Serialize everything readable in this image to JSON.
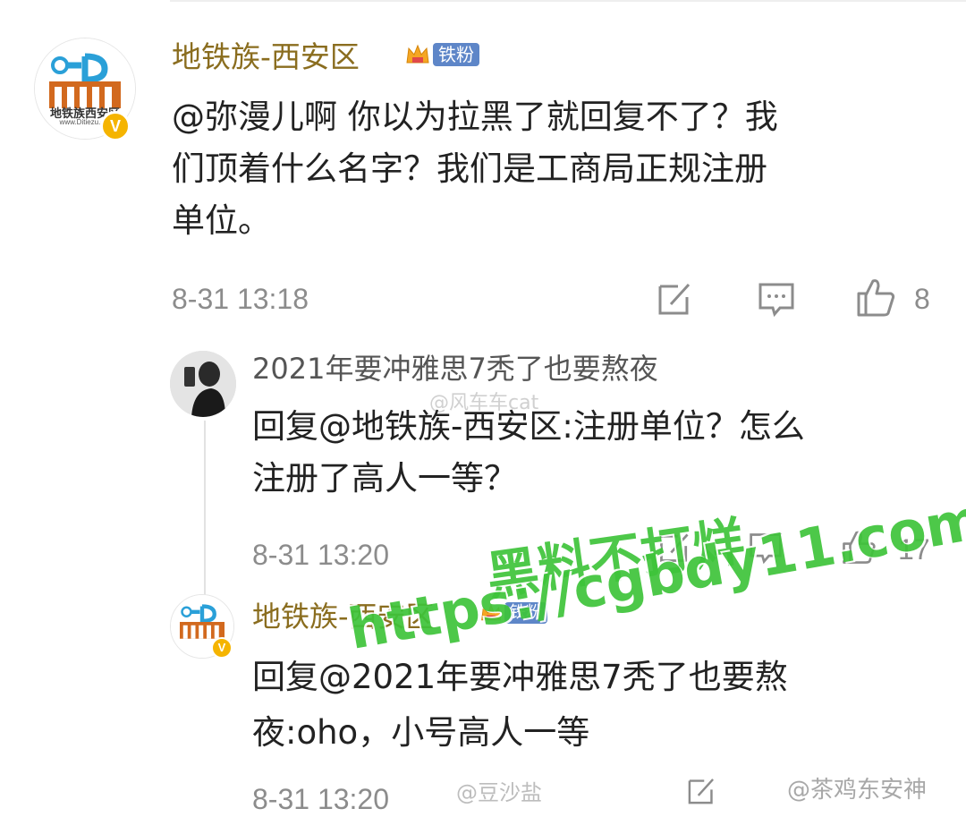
{
  "comments": [
    {
      "username": "地铁族-西安区",
      "fan_badge": "铁粉",
      "mention": "@弥漫儿啊",
      "body_line1": " 你以为拉黑了就回复不了？我",
      "body_line2": "们顶着什么名字？我们是工商局正规注册",
      "body_line3": "单位。",
      "timestamp": "8-31 13:18",
      "like_count": "8",
      "avatar_badge": "V",
      "avatar_caption": "地铁族西安区",
      "avatar_url": "www.Ditiezu.com"
    },
    {
      "username": "2021年要冲雅思7秃了也要熬夜",
      "body_line1": "回复@地铁族-西安区:注册单位？怎么",
      "body_line2": "注册了高人一等？",
      "timestamp": "8-31 13:20",
      "like_count": "17"
    },
    {
      "username": "地铁族-西安区",
      "fan_badge": "铁粉",
      "body_line1": "回复@2021年要冲雅思7秃了也要熬",
      "body_line2": "夜:oho，小号高人一等",
      "timestamp": "8-31 13:20",
      "avatar_badge": "V"
    }
  ],
  "watermarks": {
    "line1": "黑料不打烊",
    "line2": "https://cgbdy11.com",
    "weibo_1": "@风车车cat",
    "weibo_2": "@豆沙盐",
    "weibo_3": "@茶鸡东安神"
  },
  "colors": {
    "username": "#8a6d1f",
    "meta": "#8c8c8c",
    "watermark_green": "#3ec43a",
    "fan_badge": "#5e86c8"
  }
}
